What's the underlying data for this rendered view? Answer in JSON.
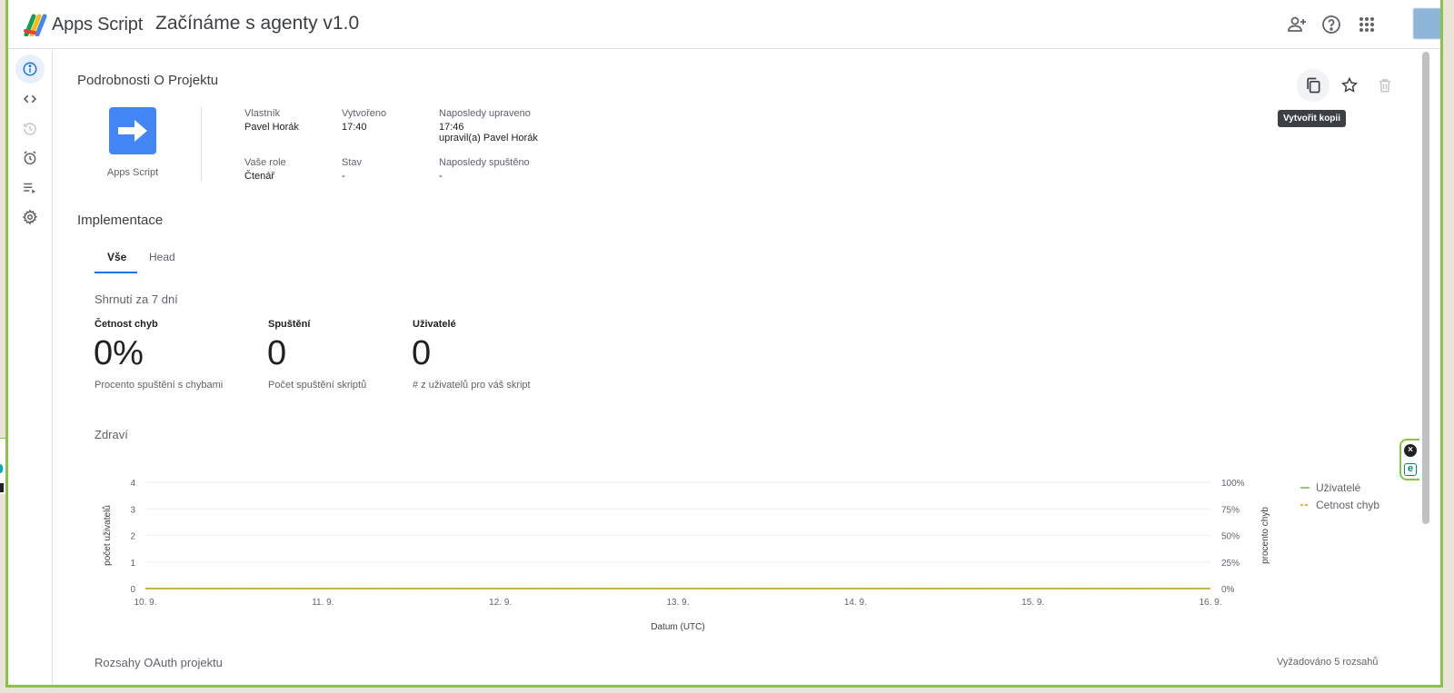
{
  "header": {
    "brand": "Apps Script",
    "project_title": "Začínáme s agenty v1.0"
  },
  "details": {
    "title": "Podrobnosti O Projektu",
    "icon_label": "Apps Script",
    "owner_label": "Vlastník",
    "owner_value": "Pavel Horák",
    "created_label": "Vytvořeno",
    "created_value": "17:40",
    "modified_label": "Naposledy upraveno",
    "modified_value": "17:46",
    "modified_by": "upravil(a) Pavel Horák",
    "role_label": "Vaše role",
    "role_value": "Čtenář",
    "status_label": "Stav",
    "status_value": "-",
    "lastrun_label": "Naposledy spuštěno",
    "lastrun_value": "-"
  },
  "actions": {
    "copy_tooltip": "Vytvořit kopii"
  },
  "deployments": {
    "title": "Implementace",
    "tabs": [
      {
        "label": "Vše",
        "active": true
      },
      {
        "label": "Head",
        "active": false
      }
    ],
    "summary_title": "Shrnutí za 7 dní",
    "stats": [
      {
        "label": "Četnost chyb",
        "value": "0%",
        "desc": "Procento spuštění s chybami"
      },
      {
        "label": "Spuštění",
        "value": "0",
        "desc": "Počet spuštění skriptů"
      },
      {
        "label": "Uživatelé",
        "value": "0",
        "desc": "# z uživatelů pro váš skript"
      }
    ],
    "health_title": "Zdraví"
  },
  "chart_data": {
    "type": "line",
    "x": [
      "10. 9.",
      "11. 9.",
      "12. 9.",
      "13. 9.",
      "14. 9.",
      "15. 9.",
      "16. 9."
    ],
    "xlabel": "Datum (UTC)",
    "ylabel": "počet uživatelů",
    "y2label": "procento chyb",
    "ylim": [
      0,
      4
    ],
    "yticks": [
      "0",
      "1",
      "2",
      "3",
      "4"
    ],
    "y2lim": [
      0,
      100
    ],
    "y2ticks": [
      "0%",
      "25%",
      "50%",
      "75%",
      "100%"
    ],
    "grid": true,
    "legend_position": "right",
    "series": [
      {
        "name": "Uživatelé",
        "axis": "left",
        "color": "#7cb342",
        "style": "solid",
        "values": [
          0,
          0,
          0,
          0,
          0,
          0,
          0
        ]
      },
      {
        "name": "Cetnost chyb",
        "axis": "right",
        "color": "#f29900",
        "style": "dashed",
        "values": [
          0,
          0,
          0,
          0,
          0,
          0,
          0
        ]
      }
    ]
  },
  "footer": {
    "oauth_title": "Rozsahy OAuth projektu",
    "scopes_count": "Vyžadováno 5 rozsahů"
  }
}
